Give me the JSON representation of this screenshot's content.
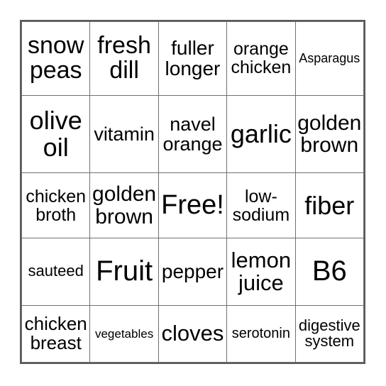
{
  "card": {
    "type": "bingo-card",
    "columns": 5,
    "rows": 5,
    "free_space_label": "Free!",
    "free_space_position": {
      "row": 3,
      "column": 3
    },
    "border_color": "#5a5a5a",
    "grid_line_color": "#707070",
    "background_color": "#ffffff",
    "text_color": "#000000",
    "cells": [
      [
        {
          "label": "snow peas",
          "size": "sz-xxl"
        },
        {
          "label": "fresh dill",
          "size": "sz-xxl"
        },
        {
          "label": "fuller longer",
          "size": "sz-l"
        },
        {
          "label": "orange chicken",
          "size": "sz-m"
        },
        {
          "label": "Asparagus",
          "size": "sz-xs"
        }
      ],
      [
        {
          "label": "olive oil",
          "size": "sz-h"
        },
        {
          "label": "vitamin",
          "size": "sz-ml"
        },
        {
          "label": "navel orange",
          "size": "sz-ml"
        },
        {
          "label": "garlic",
          "size": "sz-h"
        },
        {
          "label": "golden brown",
          "size": "sz-lx"
        }
      ],
      [
        {
          "label": "chicken broth",
          "size": "sz-m"
        },
        {
          "label": "golden brown",
          "size": "sz-lx"
        },
        {
          "label": "Free!",
          "size": "sz-hh"
        },
        {
          "label": "low-sodium",
          "size": "sz-m"
        },
        {
          "label": "fiber",
          "size": "sz-h"
        }
      ],
      [
        {
          "label": "sauteed",
          "size": "sz-sm"
        },
        {
          "label": "Fruit",
          "size": "sz-max"
        },
        {
          "label": "pepper",
          "size": "sz-l"
        },
        {
          "label": "lemon juice",
          "size": "sz-xl"
        },
        {
          "label": "B6",
          "size": "sz-max"
        }
      ],
      [
        {
          "label": "chicken breast",
          "size": "sz-mm"
        },
        {
          "label": "vegetables",
          "size": "sz-xxs"
        },
        {
          "label": "cloves",
          "size": "sz-xl"
        },
        {
          "label": "serotonin",
          "size": "sz-s"
        },
        {
          "label": "digestive system",
          "size": "sz-sm"
        }
      ]
    ]
  }
}
